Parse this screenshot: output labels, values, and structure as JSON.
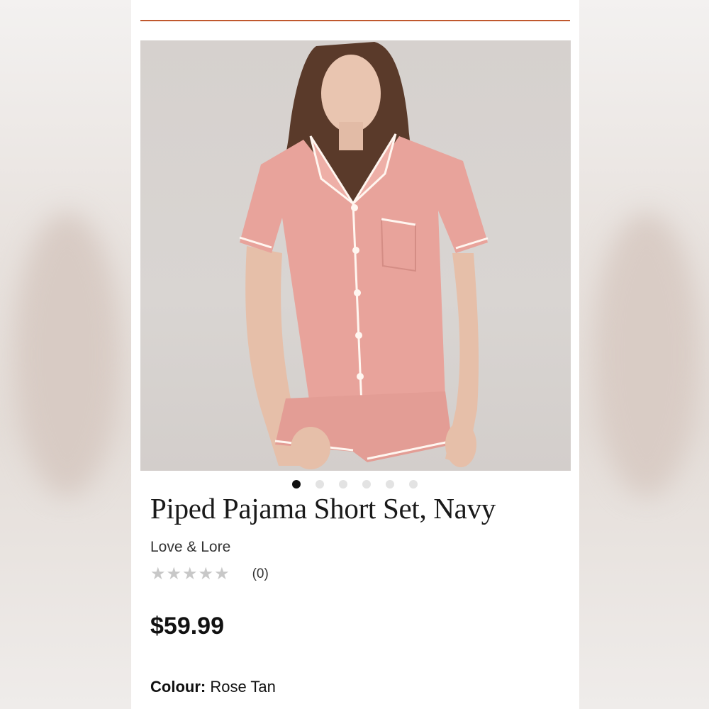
{
  "product": {
    "title": "Piped Pajama Short Set, Navy",
    "brand": "Love & Lore",
    "rating": {
      "stars": 0,
      "max_stars": 5,
      "review_count": "(0)"
    },
    "price": "$59.99",
    "colour_label": "Colour:",
    "colour_value": "Rose Tan"
  },
  "carousel": {
    "total_slides": 6,
    "active_index": 0
  },
  "colors": {
    "accent_rule": "#c0582e",
    "garment": "#e8a39b",
    "piping": "#fff6f0"
  }
}
